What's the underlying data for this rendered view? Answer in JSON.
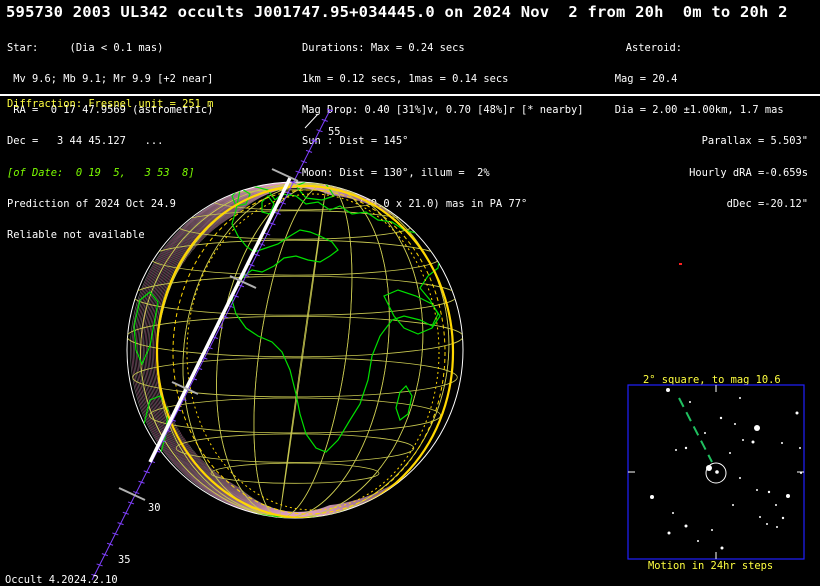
{
  "header": {
    "title": "595730 2003 UL342 occults J001747.95+034445.0 on 2024 Nov  2 from 20h  0m to 20h 2"
  },
  "star_block": [
    "Star:     (Dia < 0.1 mas)",
    " Mv 9.6; Mb 9.1; Mr 9.9 [+2 near]",
    " RA =  0 17 47.9569 (astrometric)",
    "Dec =   3 44 45.127   ...",
    "[of Date:  0 19  5,   3 53  8]",
    "Prediction of 2024 Oct 24.9",
    "Reliable not available"
  ],
  "event_block": [
    "Durations: Max = 0.24 secs",
    "1km = 0.12 secs, 1mas = 0.14 secs",
    "Mag Drop: 0.40 [31%]v, 0.70 [48%]r [* nearby]",
    "Sun : Dist = 145°",
    "Moon: Dist = 130°, illum =  2%",
    "1σ Err: ±(39.0 x 21.0) mas in PA 77°"
  ],
  "asteroid_block": [
    "Asteroid:",
    "   Mag = 20.4",
    "   Dia = 2.00 ±1.00km, 1.7 mas",
    "Parallax = 5.503\"",
    "Hourly dRA =-0.659s",
    "dDec =-20.12\""
  ],
  "diffraction_label": "Diffraction: Fresnel unit = 251 m",
  "path_labels": {
    "top": "55",
    "middle": "30",
    "bottom": "35"
  },
  "starchart": {
    "title": "2° square, to mag 10.6",
    "caption": "Motion in 24hr steps"
  },
  "footer": "Occult 4.2024.2.10",
  "colors": {
    "globe_grid": "#c8c850",
    "coastline": "#00e000",
    "path": "#ffffff",
    "error_limits": "#ffd700",
    "track_ticks": "#8040ff",
    "chart_border": "#2020ff",
    "chart_motion": "#20c060",
    "label_yellow": "#ffff40"
  }
}
